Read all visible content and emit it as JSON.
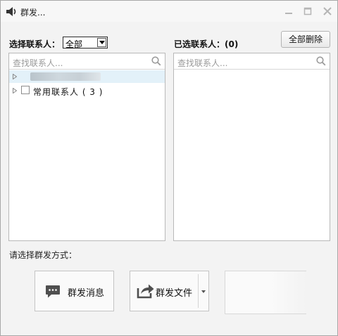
{
  "window": {
    "title": "群发..."
  },
  "left": {
    "label": "选择联系人：",
    "dropdown_value": "全部",
    "search_placeholder": "查找联系人...",
    "groups": [
      {
        "label": "常用联系人 ( 3 )"
      }
    ]
  },
  "right": {
    "label": "已选联系人：(0)",
    "delete_all": "全部删除",
    "search_placeholder": "查找联系人..."
  },
  "send": {
    "label": "请选择群发方式：",
    "message_button": "群发消息",
    "file_button": "群发文件"
  },
  "icons": [
    "speaker-icon",
    "minimize-icon",
    "maximize-icon",
    "close-icon",
    "search-icon",
    "expand-arrow-icon",
    "chat-bubble-icon",
    "share-file-icon",
    "dropdown-arrow-icon"
  ],
  "colors": {
    "highlight_row": "#e3f1f9",
    "panel_border": "#b9b9b9",
    "window_bg": "#f3f3f3"
  }
}
